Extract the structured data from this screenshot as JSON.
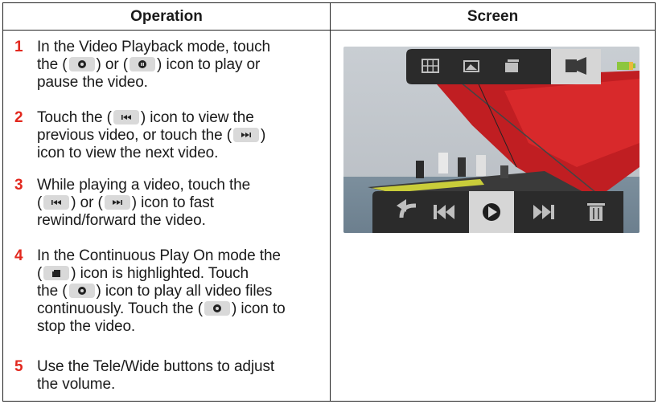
{
  "header": {
    "operation": "Operation",
    "screen": "Screen"
  },
  "steps": [
    {
      "n": "1",
      "lines": [
        "In the Video Playback mode, touch",
        "the (",
        ") or (",
        ") icon to play or",
        "pause the video."
      ]
    },
    {
      "n": "2",
      "lines": [
        "Touch the (",
        ") icon to view the",
        "previous video, or touch the (",
        ")",
        "icon to view the next video."
      ]
    },
    {
      "n": "3",
      "lines": [
        "While playing a video, touch the",
        "(",
        ") or (",
        ") icon to fast",
        "rewind/forward the video."
      ]
    },
    {
      "n": "4",
      "lines": [
        "In the Continuous Play On mode the",
        "(",
        ") icon is highlighted. Touch",
        "the (",
        ") icon to play all video files",
        "continuously. Touch the (",
        ") icon to",
        "stop the video."
      ]
    },
    {
      "n": "5",
      "lines": [
        "Use the Tele/Wide buttons to adjust",
        "the volume."
      ]
    }
  ],
  "icons": {
    "top_bar": [
      "grid-icon",
      "photo-icon",
      "video-icon",
      "continuous-play-icon",
      "battery-icon"
    ],
    "bottom_bar": [
      "back-icon",
      "previous-icon",
      "play-icon",
      "next-icon",
      "trash-icon"
    ]
  }
}
